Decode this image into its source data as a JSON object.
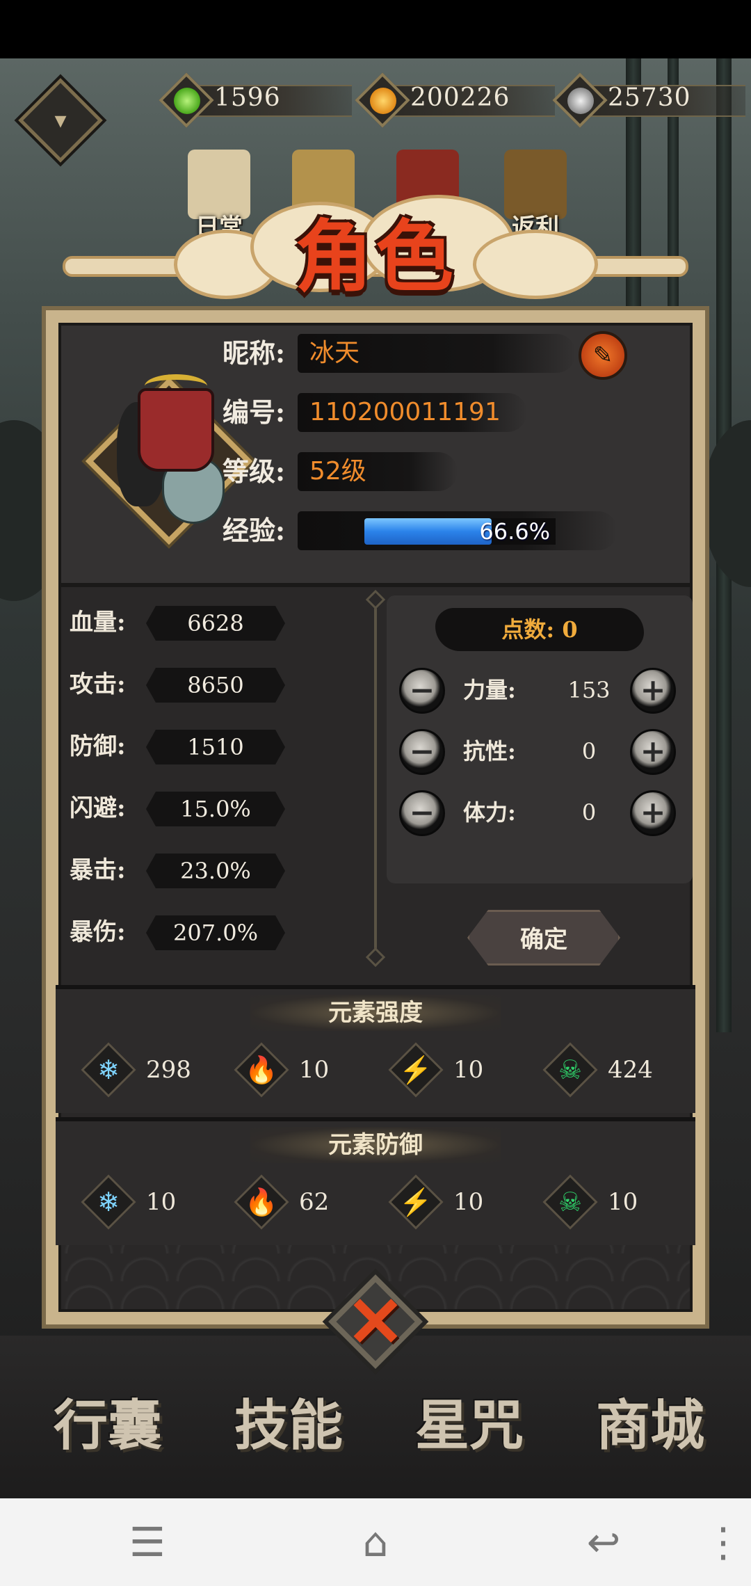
{
  "currencies": [
    {
      "icon": "green-jade-icon",
      "value": "1596",
      "color": "#6ed13a"
    },
    {
      "icon": "gold-coin-icon",
      "value": "200226",
      "color": "#f2a72a"
    },
    {
      "icon": "silver-swirl-icon",
      "value": "25730",
      "color": "#bfbfbf"
    }
  ],
  "top_tabs": [
    {
      "label": "日常",
      "icon": "scroll-icon"
    },
    {
      "label": "",
      "icon": "book-icon"
    },
    {
      "label": "",
      "icon": "torii-gate-icon"
    },
    {
      "label": "返利",
      "icon": "treasure-chest-icon"
    }
  ],
  "panel": {
    "title": "角色"
  },
  "profile": {
    "nickname_label": "昵称:",
    "nickname": "冰天",
    "id_label": "编号:",
    "id": "110200011191",
    "level_label": "等级:",
    "level": "52级",
    "exp_label": "经验:",
    "exp_text": "66.6%",
    "exp_fraction": 0.666
  },
  "stats": [
    {
      "name": "血量:",
      "value": "6628"
    },
    {
      "name": "攻击:",
      "value": "8650"
    },
    {
      "name": "防御:",
      "value": "1510"
    },
    {
      "name": "闪避:",
      "value": "15.0%"
    },
    {
      "name": "暴击:",
      "value": "23.0%"
    },
    {
      "name": "暴伤:",
      "value": "207.0%"
    }
  ],
  "points": {
    "label": "点数: 0",
    "attributes": [
      {
        "name": "力量:",
        "value": "153"
      },
      {
        "name": "抗性:",
        "value": "0"
      },
      {
        "name": "体力:",
        "value": "0"
      }
    ],
    "minus_symbol": "−",
    "plus_symbol": "+",
    "confirm_label": "确定"
  },
  "element_strength": {
    "title": "元素强度",
    "items": [
      {
        "icon": "ice-snowflake-icon",
        "glyph": "❄",
        "color": "#7fd4ff",
        "value": "298"
      },
      {
        "icon": "fire-icon",
        "glyph": "🔥",
        "color": "#ff8a2a",
        "value": "10"
      },
      {
        "icon": "lightning-icon",
        "glyph": "⚡",
        "color": "#b56cff",
        "value": "10"
      },
      {
        "icon": "poison-skull-icon",
        "glyph": "☠",
        "color": "#2fd16a",
        "value": "424"
      }
    ]
  },
  "element_defense": {
    "title": "元素防御",
    "items": [
      {
        "icon": "ice-snowflake-icon",
        "glyph": "❄",
        "color": "#7fd4ff",
        "value": "10"
      },
      {
        "icon": "fire-icon",
        "glyph": "🔥",
        "color": "#ff8a2a",
        "value": "62"
      },
      {
        "icon": "lightning-icon",
        "glyph": "⚡",
        "color": "#b56cff",
        "value": "10"
      },
      {
        "icon": "poison-skull-icon",
        "glyph": "☠",
        "color": "#2fd16a",
        "value": "10"
      }
    ]
  },
  "bottom_menu": [
    "行囊",
    "技能",
    "星咒",
    "商城"
  ],
  "nav": {
    "menu_glyph": "☰",
    "home_glyph": "⌂",
    "back_glyph": "↩",
    "more_glyph": "⋮"
  },
  "colors": {
    "accent": "#e8431c",
    "value_orange": "#f08c2c",
    "points_gold": "#f0ab3c"
  }
}
